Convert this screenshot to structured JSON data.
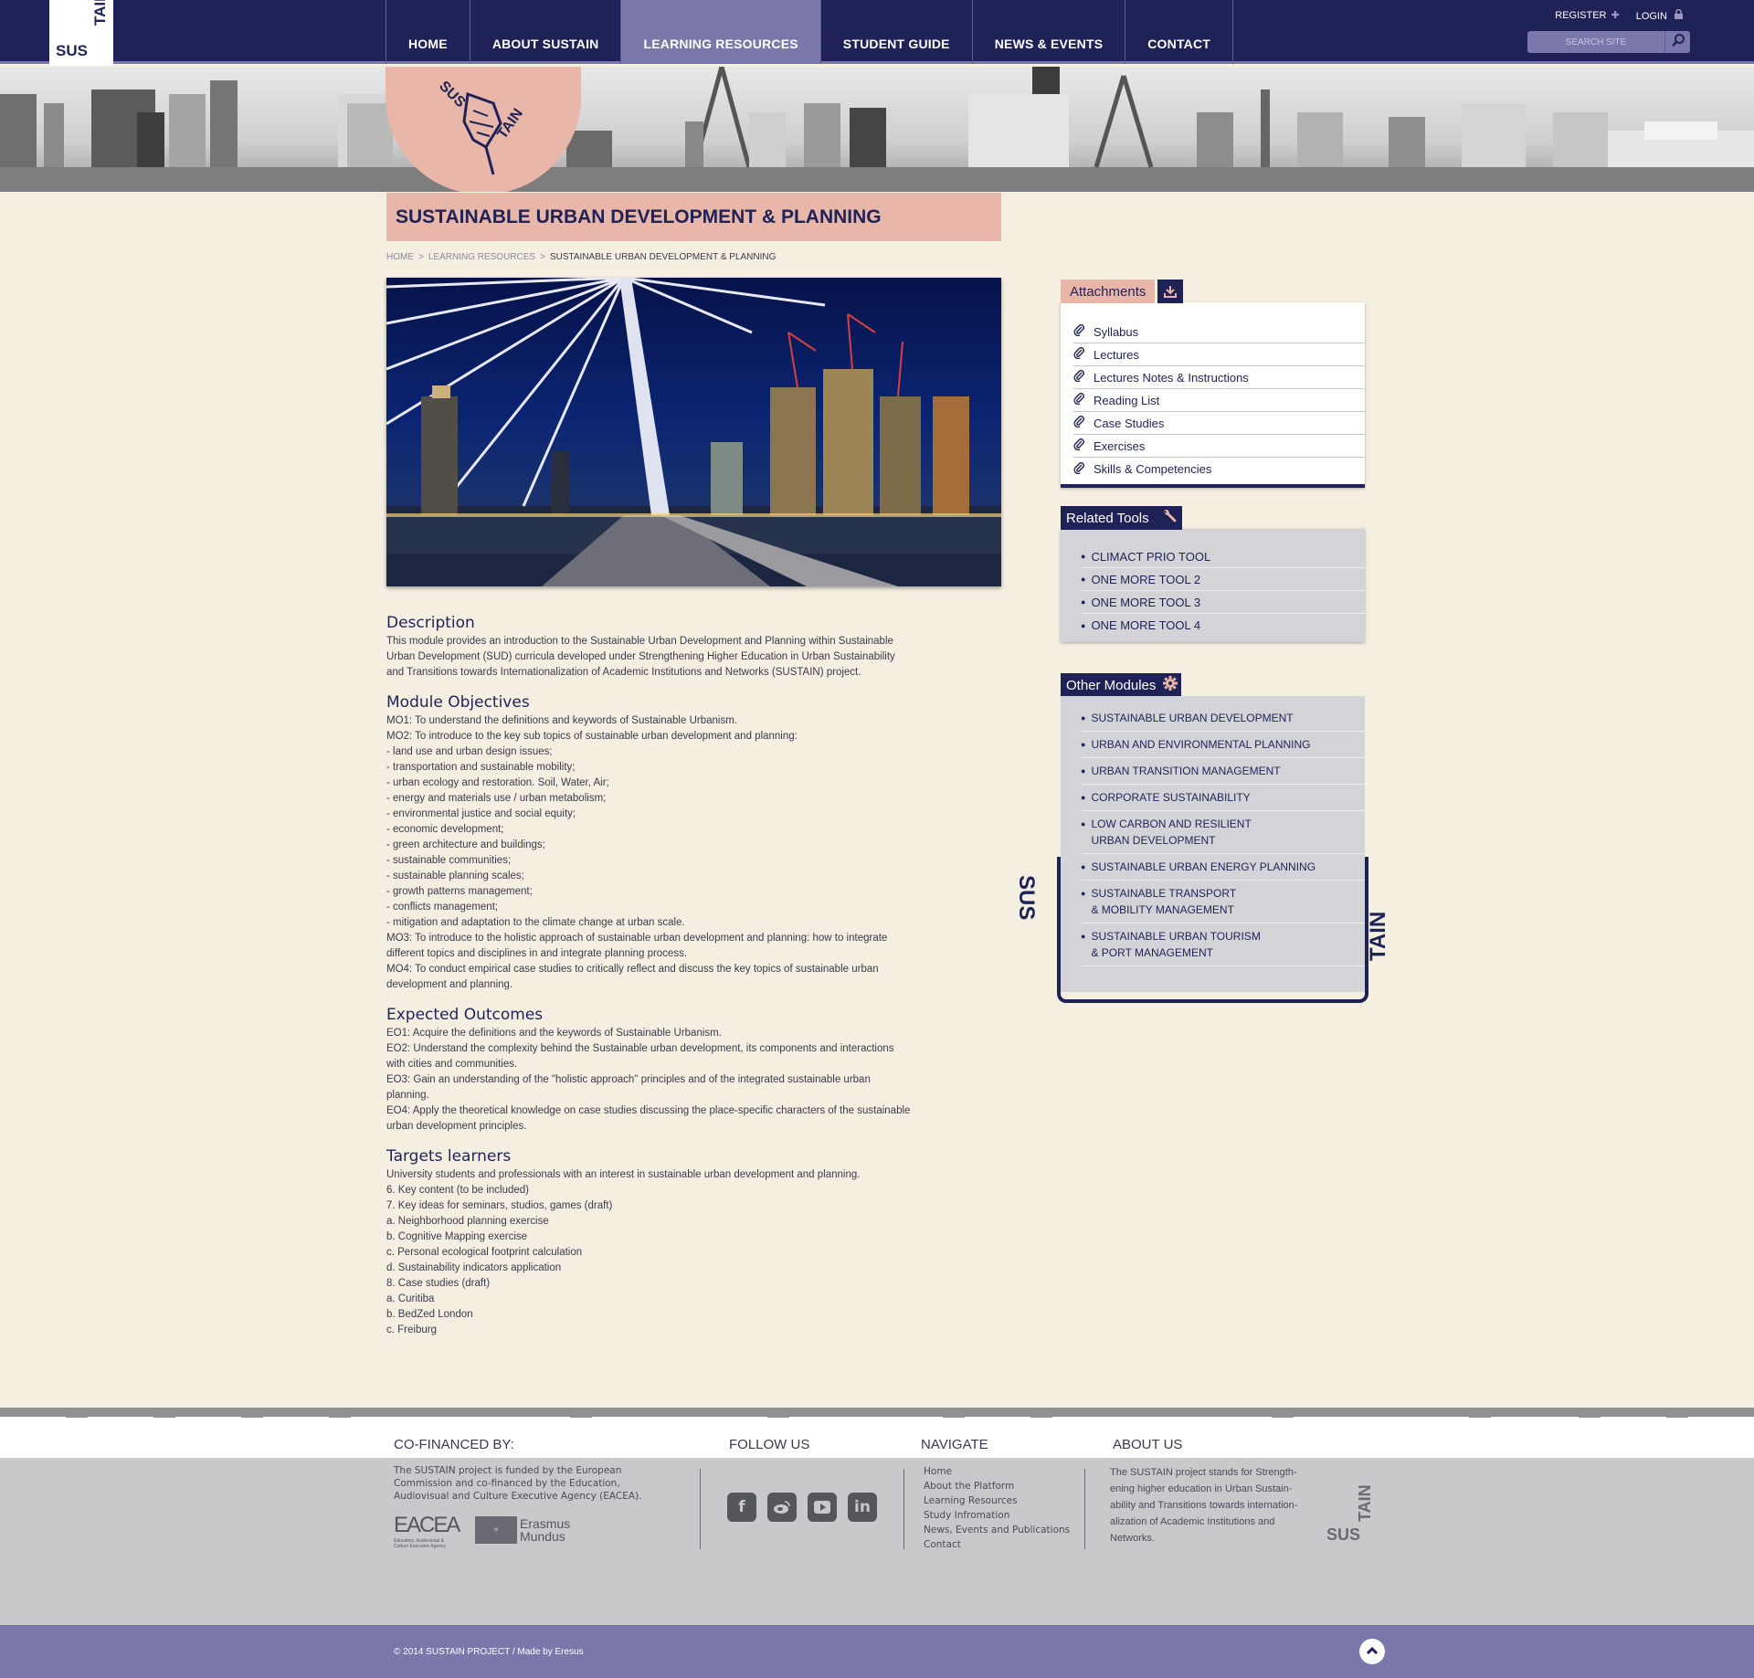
{
  "header": {
    "logo_top": "TAIN",
    "logo_bottom": "SUS",
    "nav": [
      {
        "label": "HOME",
        "active": false
      },
      {
        "label": "ABOUT SUSTAIN",
        "active": false
      },
      {
        "label": "LEARNING RESOURCES",
        "active": true
      },
      {
        "label": "STUDENT GUIDE",
        "active": false
      },
      {
        "label": "NEWS & EVENTS",
        "active": false
      },
      {
        "label": "CONTACT",
        "active": false
      }
    ],
    "register_label": "REGISTER",
    "login_label": "LOGIN",
    "search_placeholder": "SEARCH SITE"
  },
  "badge": {
    "top": "SUS",
    "bottom": "TAIN"
  },
  "page_title": "SUSTAINABLE URBAN DEVELOPMENT & PLANNING",
  "breadcrumb": {
    "items": [
      "HOME",
      "LEARNING RESOURCES"
    ],
    "separator": ">",
    "current": "SUSTAINABLE URBAN DEVELOPMENT & PLANNING"
  },
  "content": {
    "description_heading": "Description",
    "description_text": "This module provides an introduction to the Sustainable Urban Development and Planning within Sustainable Urban Development (SUD) curricula developed under Strengthening Higher Education in Urban Sustainability and Transitions towards Internationalization of Academic Institutions and Networks (SUSTAIN) project.",
    "objectives_heading": "Module Objectives",
    "objectives_lines": [
      "MO1: To understand the definitions and keywords of Sustainable Urbanism.",
      "MO2: To introduce to the key sub topics of sustainable urban development and planning:",
      "- land use and urban design issues;",
      "- transportation and sustainable mobility;",
      "- urban ecology and restoration. Soil, Water, Air;",
      "- energy and materials use / urban metabolism;",
      "- environmental justice and social equity;",
      "- economic development;",
      "- green architecture and buildings;",
      "- sustainable communities;",
      "- sustainable planning scales;",
      "- growth patterns management;",
      "- conflicts management;",
      "- mitigation and adaptation to the climate change at urban scale.",
      "MO3: To introduce to the holistic approach of sustainable urban development and planning: how to integrate different topics and disciplines in and integrate planning process.",
      "MO4: To conduct empirical case studies to critically reflect and discuss the key topics of sustainable urban development and planning."
    ],
    "outcomes_heading": "Expected Outcomes",
    "outcomes_lines": [
      "EO1: Acquire the definitions and the keywords of Sustainable Urbanism.",
      "EO2: Understand the complexity behind the Sustainable urban development, its components and interactions with cities and communities.",
      "EO3: Gain an understanding of the \"holistic approach\" principles and of the integrated sustainable urban planning.",
      "EO4: Apply the theoretical knowledge on case studies discussing the place-specific characters of the sustainable urban development principles."
    ],
    "learners_heading": "Targets learners",
    "learners_lines": [
      "University students and professionals with an interest in sustainable urban development and planning.",
      "6. Key content (to be included)",
      "7. Key ideas for seminars, studios, games (draft)",
      "a. Neighborhood planning exercise",
      "b. Cognitive Mapping exercise",
      "c. Personal ecological footprint calculation",
      "d. Sustainability indicators application",
      "8. Case studies (draft)",
      "a. Curitiba",
      "b. BedZed London",
      "c. Freiburg"
    ]
  },
  "sidebar": {
    "attachments_title": "Attachments",
    "attachments": [
      "Syllabus",
      "Lectures",
      "Lectures Notes & Instructions",
      "Reading List",
      "Case Studies",
      "Exercises",
      "Skills & Competencies"
    ],
    "tools_title": "Related Tools",
    "tools": [
      "CLIMACT PRIO TOOL",
      "ONE MORE TOOL 2",
      "ONE MORE TOOL 3",
      "ONE MORE TOOL 4"
    ],
    "modules_title": "Other Modules",
    "modules": [
      {
        "line1": "SUSTAINABLE URBAN DEVELOPMENT",
        "line2": ""
      },
      {
        "line1": "URBAN AND ENVIRONMENTAL PLANNING",
        "line2": ""
      },
      {
        "line1": "URBAN TRANSITION MANAGEMENT",
        "line2": ""
      },
      {
        "line1": "CORPORATE SUSTAINABILITY",
        "line2": ""
      },
      {
        "line1": "LOW CARBON AND RESILIENT",
        "line2": "URBAN DEVELOPMENT"
      },
      {
        "line1": "SUSTAINABLE URBAN ENERGY PLANNING",
        "line2": ""
      },
      {
        "line1": "SUSTAINABLE TRANSPORT",
        "line2": "& MOBILITY MANAGEMENT"
      },
      {
        "line1": "SUSTAINABLE URBAN TOURISM",
        "line2": "& PORT MANAGEMENT"
      }
    ],
    "frame_left": "SUS",
    "frame_right": "TAIN"
  },
  "footer": {
    "cofinanced_heading": "CO-FINANCED BY:",
    "cofinanced_text": "The SUSTAIN project is funded by the European Commission and co-financed by the Education, Audiovisual and Culture Executive Agency (EACEA).",
    "eacea_logo": "EACEA",
    "eacea_sub": "Education, Audiovisual & Culture Executive Agency",
    "erasmus_logo_1": "Erasmus",
    "erasmus_logo_2": "Mundus",
    "follow_heading": "FOLLOW US",
    "social": [
      "facebook-icon",
      "weibo-icon",
      "youtube-icon",
      "linkedin-icon"
    ],
    "navigate_heading": "NAVIGATE",
    "navigate_links": [
      "Home",
      "About the Platform",
      "Learning Resources",
      "Study Infromation",
      "News, Events and Publications",
      "Contact"
    ],
    "about_heading": "ABOUT US",
    "about_lines": [
      "The SUSTAIN project stands for Strength-",
      "ening higher education in Urban Sustain-",
      "ability and Transitions towards internation-",
      "alization of Academic Institutions and",
      "Networks."
    ],
    "logo_top": "TAIN",
    "logo_bottom": "SUS",
    "copyright": "© 2014 SUSTAIN PROJECT / Made by Eresus"
  },
  "colors": {
    "navy": "#1e2257",
    "lavender": "#7a77aa",
    "salmon": "#e8b7aa",
    "cream": "#f5efe2",
    "panel_grey": "#d4d4d8"
  }
}
